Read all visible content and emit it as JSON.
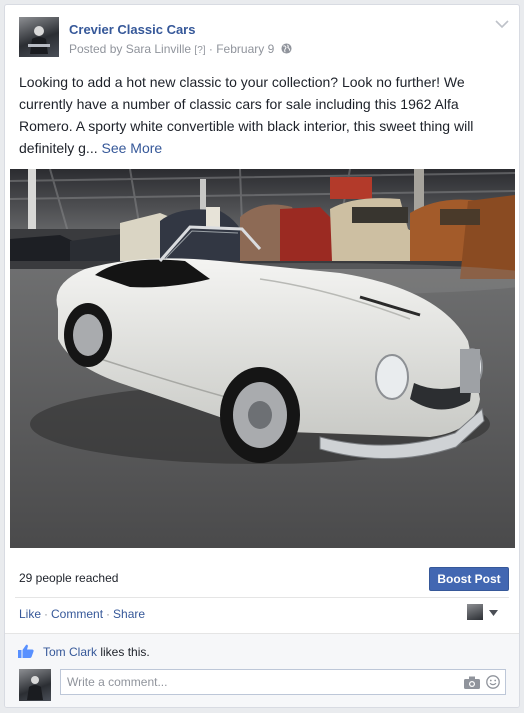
{
  "post": {
    "page_name": "Crevier Classic Cars",
    "meta_prefix": "Posted by ",
    "author": "Sara Linville",
    "help_marker": "[?]",
    "date_sep": " · ",
    "date": "February 9",
    "text": "Looking to add a hot new classic to your collection? Look no further! We currently have a number of classic cars for sale including this 1962 Alfa Romero. A sporty white convertible with black interior, this sweet thing will definitely g...",
    "see_more": "See More",
    "photo_icon": "car-photo"
  },
  "insights": {
    "reach": "29 people reached",
    "boost_label": "Boost Post"
  },
  "actions": {
    "like": "Like",
    "comment": "Comment",
    "share": "Share",
    "separator": "·"
  },
  "likes": {
    "name": "Tom Clark",
    "suffix": " likes this."
  },
  "comment_box": {
    "placeholder": "Write a comment..."
  },
  "colors": {
    "link": "#365899",
    "boost": "#4267b2",
    "muted": "#90949c"
  }
}
